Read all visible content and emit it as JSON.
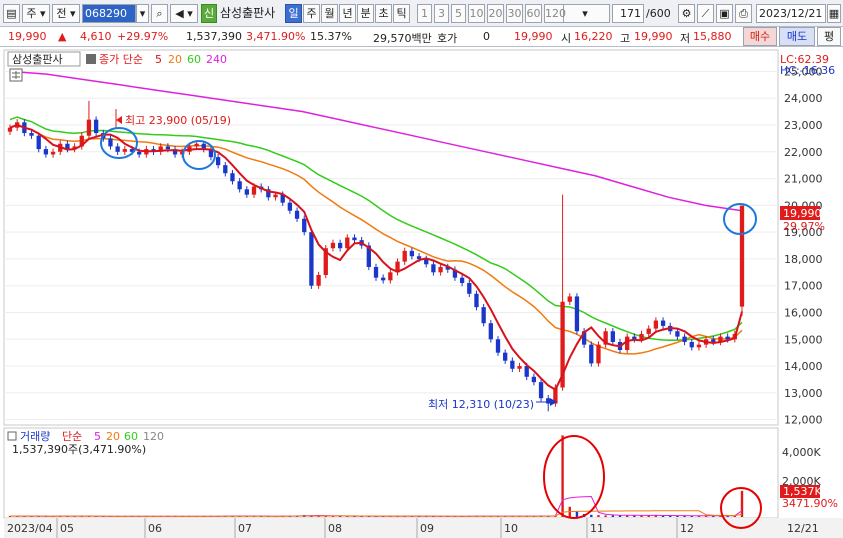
{
  "toolbar": {
    "type_label": "주",
    "prev_label": "전",
    "stock_code": "068290",
    "volume_icon": "speaker-icon",
    "new_badge": "신",
    "stock_name": "삼성출판사",
    "periods": [
      "일",
      "주",
      "월",
      "년",
      "분",
      "초",
      "틱"
    ],
    "active_period": "일",
    "intervals": [
      "1",
      "3",
      "5",
      "10",
      "20",
      "30",
      "60",
      "120"
    ],
    "count": "171",
    "count_total": "/600",
    "date": "2023/12/21"
  },
  "quote": {
    "price": "19,990",
    "change": "4,610",
    "change_pct": "+29.97%",
    "volume": "1,537,390",
    "volume_pct": "3,471.90%",
    "turnover": "15.37%",
    "amount": "29,570백만",
    "bid_label": "호가",
    "bid_value": "0",
    "current": "19,990",
    "open_label": "시",
    "open": "16,220",
    "high_label": "고",
    "high": "19,990",
    "low_label": "저",
    "low": "15,880",
    "buy_label": "매수",
    "sell_label": "매도",
    "eval_label": "평"
  },
  "price_pane": {
    "name": "삼성출판사",
    "indicator": "종가 단순",
    "ma_periods": [
      "5",
      "20",
      "60",
      "240"
    ],
    "lc": "LC:62.39",
    "hc": "HC:-16.36",
    "y_ticks": [
      "25,000",
      "24,000",
      "23,000",
      "22,000",
      "21,000",
      "20,000",
      "19,000",
      "18,000",
      "17,000",
      "16,000",
      "15,000",
      "14,000",
      "13,000",
      "12,000"
    ],
    "last_price_tag": "19,990",
    "last_pct_tag": "29.97%",
    "high_note": "최고 23,900 (05/19)",
    "low_note": "최저 12,310 (10/23)"
  },
  "volume_pane": {
    "name": "거래량",
    "indicator": "단순",
    "ma_periods": [
      "5",
      "20",
      "60",
      "120"
    ],
    "info": "1,537,390주(3,471.90%)",
    "y_ticks": [
      "4,000K",
      "2,000K"
    ],
    "last_vol_tag": "1,537K",
    "last_pct_tag": "3471.90%"
  },
  "x_axis": {
    "labels": [
      "2023/04",
      "05",
      "06",
      "07",
      "08",
      "09",
      "10",
      "11",
      "12",
      "12/21"
    ]
  },
  "colors": {
    "up": "#e01b1b",
    "down": "#1a37c9",
    "ma5": "#d8121b",
    "ma20": "#f07a10",
    "ma60": "#33cc1a",
    "ma240": "#dd22dd",
    "circle_blue": "#1e78dc",
    "circle_red": "#e60000"
  },
  "chart_data": {
    "type": "candlestick",
    "period": "daily",
    "x_range": [
      "2023-04-20",
      "2023-12-21"
    ],
    "y_range": [
      12000,
      25500
    ],
    "highest": {
      "value": 23900,
      "date": "05/19"
    },
    "lowest": {
      "value": 12310,
      "date": "10/23"
    },
    "last": {
      "open": 16220,
      "high": 19990,
      "low": 15880,
      "close": 19990,
      "volume": 1537390
    },
    "series": [
      {
        "name": "종가",
        "close": [
          22900,
          23100,
          22700,
          22600,
          22100,
          21900,
          22000,
          22300,
          22100,
          22200,
          22600,
          23200,
          22700,
          22500,
          22200,
          22000,
          22100,
          22000,
          21900,
          22100,
          22000,
          22200,
          22100,
          21900,
          22000,
          22200,
          22300,
          22100,
          21800,
          21500,
          21200,
          20900,
          20600,
          20400,
          20700,
          20600,
          20300,
          20400,
          20100,
          19800,
          19500,
          19000,
          17000,
          17400,
          18400,
          18600,
          18400,
          18800,
          18700,
          18500,
          17700,
          17300,
          17200,
          17500,
          17900,
          18300,
          18100,
          18000,
          17800,
          17500,
          17700,
          17600,
          17300,
          17100,
          16700,
          16200,
          15600,
          15000,
          14500,
          14200,
          13900,
          14000,
          13600,
          13400,
          12800,
          12600,
          13200,
          16400,
          16600,
          15300,
          14800,
          14100,
          14800,
          15300,
          14900,
          14600,
          15100,
          15000,
          15200,
          15400,
          15700,
          15500,
          15300,
          15100,
          14900,
          14700,
          14800,
          15000,
          14900,
          15100,
          15000,
          15200,
          19990
        ]
      },
      {
        "name": "5",
        "values": "MA5 of close"
      },
      {
        "name": "20",
        "values": "MA20 of close"
      },
      {
        "name": "60",
        "values": "MA60 of close"
      },
      {
        "name": "240",
        "values": [
          25000,
          24900,
          24700,
          24500,
          24300,
          24100,
          23900,
          23700,
          23500,
          23200,
          22900,
          22600,
          22300,
          22000,
          21700,
          21400,
          21100,
          20700,
          20300,
          20000,
          19800
        ]
      }
    ],
    "volume": [
      60,
      50,
      40,
      55,
      45,
      50,
      40,
      60,
      70,
      55,
      50,
      45,
      40,
      40,
      35,
      50,
      45,
      40,
      35,
      40,
      45,
      40,
      35,
      50,
      40,
      45,
      40,
      45,
      60,
      50,
      55,
      70,
      60,
      50,
      55,
      50,
      45,
      40,
      60,
      70,
      90,
      120,
      80,
      70,
      65,
      55,
      60,
      50,
      45,
      40,
      55,
      45,
      50,
      40,
      55,
      40,
      45,
      40,
      35,
      50,
      40,
      45,
      40,
      50,
      60,
      55,
      50,
      45,
      60,
      55,
      50,
      45,
      60,
      55,
      70,
      60,
      80,
      4800,
      600,
      320,
      180,
      130,
      110,
      95,
      100,
      90,
      120,
      85,
      90,
      95,
      100,
      80,
      70,
      75,
      80,
      70,
      60,
      65,
      75,
      80,
      70,
      90,
      1537
    ]
  }
}
